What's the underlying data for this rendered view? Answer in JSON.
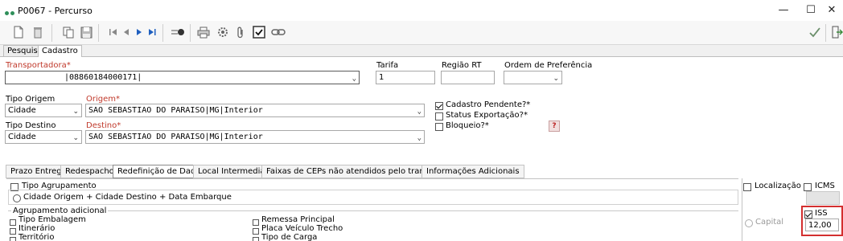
{
  "window": {
    "title": "P0067 - Percurso",
    "controls": {
      "minimize": "—",
      "maximize": "☐",
      "close": "✕"
    }
  },
  "toolbar": {
    "icons": [
      "new-doc-icon",
      "delete-icon",
      "copy-icon",
      "save-icon",
      "first-record-icon",
      "prev-record-icon",
      "next-record-icon",
      "last-record-icon",
      "audit-icon",
      "print-icon",
      "settings-icon",
      "attach-icon",
      "check-icon",
      "link-icon",
      "confirm-icon",
      "exit-icon"
    ]
  },
  "tabs": [
    "Pesquisa",
    "Cadastro"
  ],
  "form": {
    "transportadora_label": "Transportadora*",
    "transportadora_value": "|08860184000171|",
    "tarifa_label": "Tarifa",
    "tarifa_value": "1",
    "regiao_label": "Região RT",
    "regiao_value": "",
    "ordem_label": "Ordem de Preferência",
    "ordem_value": "",
    "tipo_origem_label": "Tipo Origem",
    "tipo_origem_value": "Cidade",
    "origem_label": "Origem*",
    "origem_value": "SAO SEBASTIAO DO PARAISO|MG|Interior",
    "tipo_destino_label": "Tipo Destino",
    "tipo_destino_value": "Cidade",
    "destino_label": "Destino*",
    "destino_value": "SAO SEBASTIAO DO PARAISO|MG|Interior",
    "cadastro_pendente_label": "Cadastro Pendente?*",
    "status_exportacao_label": "Status Exportação?*",
    "bloqueio_label": "Bloqueio?*",
    "help_label": "?"
  },
  "subtabs": [
    "Prazo Entrega",
    "Redespacho",
    "Redefinição de Dados",
    "Local Intermediário",
    "Faixas de CEPs não atendidos pelo transportador",
    "Informações Adicionais"
  ],
  "redefinicao": {
    "tipo_agrupamento_label": "Tipo Agrupamento",
    "radio_option": "Cidade Origem + Cidade Destino + Data Embarque",
    "agrupamento_adicional_label": "Agrupamento adicional",
    "left_items": [
      "Tipo Embalagem",
      "Itinerário",
      "Território"
    ],
    "right_items": [
      "Remessa Principal",
      "Placa Veículo Trecho",
      "Tipo de Carga"
    ]
  },
  "right_panel": {
    "localizacao_label": "Localização",
    "icms_label": "ICMS",
    "iss_label": "ISS",
    "capital_label": "Capital",
    "iss_value": "12,00",
    "highlight_color": "#d32f2f"
  }
}
